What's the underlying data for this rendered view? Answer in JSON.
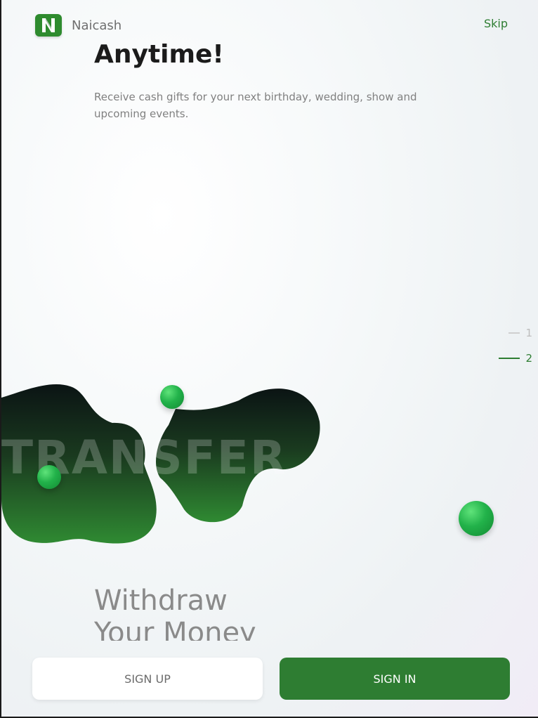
{
  "colors": {
    "accent": "#2e7d32",
    "logo_bg": "#2e8b2e",
    "blob_top": "#0b1414",
    "blob_bottom": "#2f8a32"
  },
  "header": {
    "app_name": "Naicash",
    "logo_icon": "n-logo-icon",
    "skip_label": "Skip"
  },
  "slide": {
    "headline": "Anytime!",
    "subtitle": "Receive cash gifts for your next birthday, wedding, show and upcoming events.",
    "art_text": "TRANSFER"
  },
  "pager": {
    "items": [
      {
        "label": "1",
        "active": false
      },
      {
        "label": "2",
        "active": true
      }
    ]
  },
  "next_slide": {
    "title_line1": "Withdraw",
    "title_line2": "Your Money"
  },
  "actions": {
    "signup_label": "SIGN UP",
    "signin_label": "SIGN IN"
  }
}
